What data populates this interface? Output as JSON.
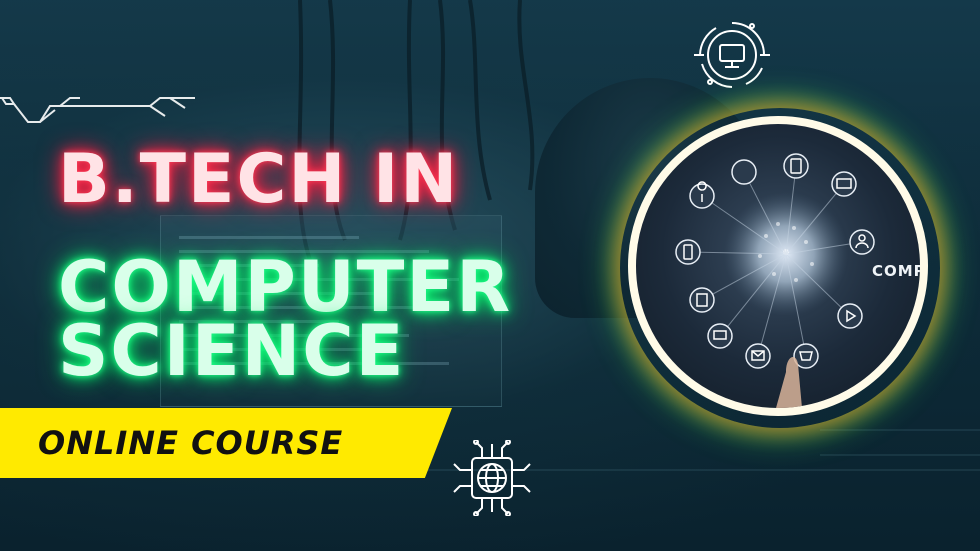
{
  "headline": {
    "line1": "B.TECH IN",
    "line2": "COMPUTER",
    "line3": "SCIENCE"
  },
  "ribbon": {
    "label": "ONLINE COURSE"
  },
  "circle_image": {
    "label": "COMPUTE"
  },
  "icons": {
    "top": "monitor-chip-icon",
    "bottom": "globe-circuit-icon",
    "left": "circuit-line-icon",
    "ring_nodes": [
      "location-pin-icon",
      "globe-icon",
      "mobile-icon",
      "laptop-icon",
      "mobile-icon",
      "person-icon",
      "document-icon",
      "monitor-icon",
      "mail-icon",
      "cart-icon",
      "play-icon"
    ]
  },
  "colors": {
    "title_red_glow": "#ff2848",
    "title_green_glow": "#0aff74",
    "ribbon": "#ffea00",
    "ring": "#fffbe8",
    "ring_glow_orange": "#ff8c1e",
    "ring_glow_green": "#46ff5a"
  }
}
